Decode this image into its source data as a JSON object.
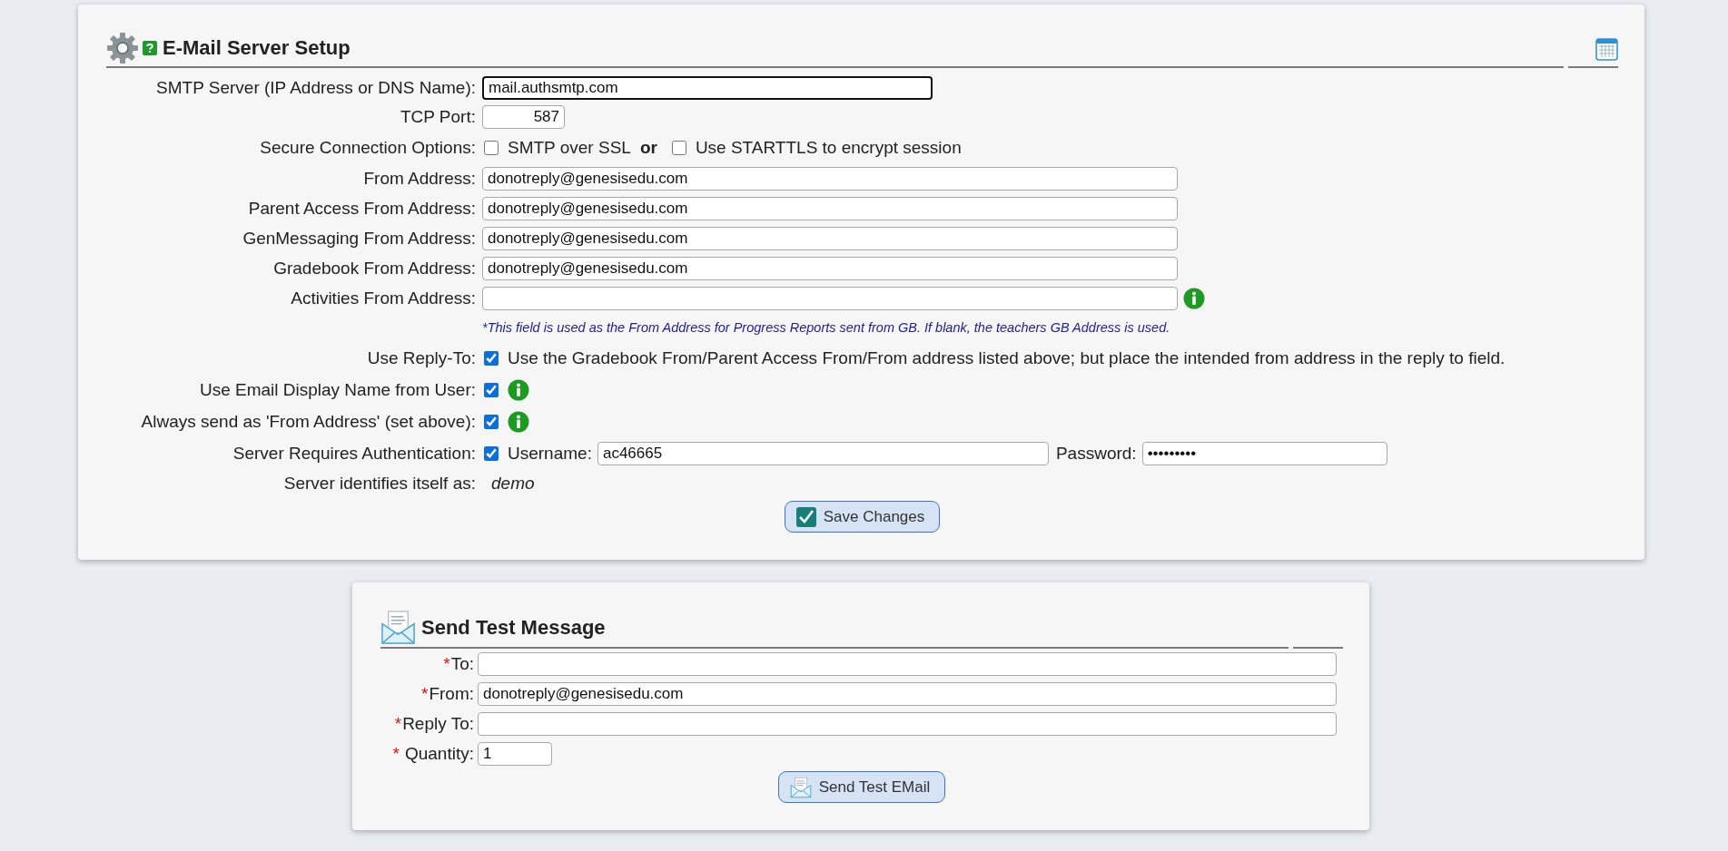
{
  "server_setup": {
    "title": "E-Mail Server Setup",
    "rows": [
      {
        "kind": "server",
        "label": "SMTP Server (IP Address or DNS Name):",
        "value": "mail.authsmtp.com",
        "focused": true
      },
      {
        "kind": "port",
        "label": "TCP Port:",
        "value": "587"
      },
      {
        "kind": "options",
        "label": "Secure Connection Options:",
        "options": [
          {
            "label": "SMTP over SSL",
            "checked": false
          },
          {
            "label": "Use STARTTLS to encrypt session",
            "checked": false
          }
        ],
        "separator": "or"
      },
      {
        "kind": "address",
        "label": "From Address:",
        "value": "donotreply@genesisedu.com"
      },
      {
        "kind": "address",
        "label": "Parent Access From Address:",
        "value": "donotreply@genesisedu.com"
      },
      {
        "kind": "address",
        "label": "GenMessaging From Address:",
        "value": "donotreply@genesisedu.com"
      },
      {
        "kind": "address",
        "label": "Gradebook From Address:",
        "value": "donotreply@genesisedu.com"
      },
      {
        "kind": "address",
        "label": "Activities From Address:",
        "info": true
      },
      {
        "kind": "hint",
        "text": "*This field is used as the From Address for Progress Reports sent from GB. If blank, the teachers GB Address is used."
      },
      {
        "kind": "checkbox",
        "label": "Use Reply-To:",
        "checked": true,
        "description": "Use the Gradebook From/Parent Access From/From address listed above; but place the intended from address in the reply to field."
      },
      {
        "kind": "checkbox",
        "label": "Use Email Display Name from User:",
        "checked": true,
        "info": true
      },
      {
        "kind": "checkbox",
        "label": "Always send as 'From Address' (set above):",
        "checked": true,
        "info": true
      },
      {
        "kind": "auth",
        "label": "Server Requires Authentication:",
        "checked": true,
        "username_label": "Username:",
        "username": "ac46665",
        "password_label": "Password:",
        "password": "•••••••••"
      },
      {
        "kind": "readonly",
        "label": "Server identifies itself as:",
        "value": "demo"
      }
    ],
    "save_button": "Save Changes"
  },
  "test_message": {
    "title": "Send Test Message",
    "fields": [
      {
        "kind": "text",
        "marker": "*",
        "label": "To:"
      },
      {
        "kind": "text",
        "marker": "*",
        "label": "From:",
        "value": "donotreply@genesisedu.com"
      },
      {
        "kind": "text",
        "marker": "*",
        "label": "Reply To:"
      },
      {
        "kind": "quantity",
        "marker": "*",
        "label": "Quantity:",
        "value": "1"
      }
    ],
    "send_button": "Send Test EMail"
  }
}
